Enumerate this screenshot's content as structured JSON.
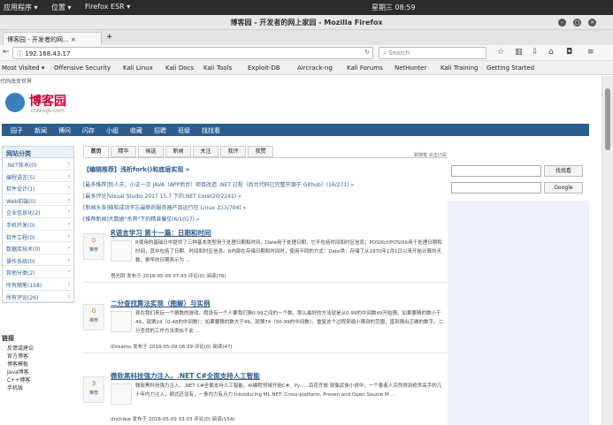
{
  "gnome": {
    "apps": "应用程序 ▾",
    "places": "位置 ▾",
    "firefox": "Firefox ESR ▾",
    "clock": "星期三 08:59"
  },
  "window": {
    "title": "博客园 - 开发者的网上家园 - Mozilla Firefox"
  },
  "tab": {
    "label": "博客园 - 开发者的网... ×",
    "new_tab": "+"
  },
  "nav": {
    "url": "192.168.43.17",
    "search_placeholder": "Search"
  },
  "bookmarks": [
    "Most Visited ▾",
    "Offensive Security",
    "Kali Linux",
    "Kali Docs",
    "Kali Tools",
    "Exploit-DB",
    "Aircrack-ng",
    "Kali Forums",
    "NetHunter",
    "Kali Training",
    "Getting Started"
  ],
  "page": {
    "topline": "代码改变世界",
    "logo_name": "博客园",
    "logo_sub": "cnblogs.com",
    "menu": [
      "园子",
      "新闻",
      "博问",
      "闪存",
      "小组",
      "收藏",
      "招聘",
      "班级",
      "找找看"
    ],
    "sidebar_title": "网站分类",
    "sidebar_items": [
      ".NET技术(0)",
      "编程语言(5)",
      "软件设计(1)",
      "Web前端(0)",
      "企业信息化(2)",
      "手机开发(0)",
      "软件工程(0)",
      "数据库技术(0)",
      "操作系统(0)",
      "其他分类(2)",
      "所有随笔(158)",
      "所有评论(26)"
    ],
    "links_title": "链接",
    "links": [
      "反馈或建议",
      "官方博客",
      "博客模板",
      "Java博客",
      "C++博客",
      "手机版"
    ],
    "tabs": [
      "首页",
      "精华",
      "候选",
      "新闻",
      "关注",
      "我评",
      "我赞"
    ],
    "hint": "新随笔  点击订阅",
    "rec_title": "【编辑推荐】浅析fork()和底层实现 »",
    "news": [
      "[最多推荐]别人夫，小证一次 JAVA（APP后台）项目改造 .NET 过程（后台代码已完整开源于 Github）(16/271) »",
      "[最多评论]Visual Studio 2017 15.7 下的.NET Core(20/2241) »",
      "[新闻头条]微软成功不忘最新的服务器产品运行在 Linux 上(3/704) »",
      "[推荐新闻]大数据\"杀熟\"下的精准偏见(6/1017) »"
    ],
    "posts": [
      {
        "votes": "0",
        "vote_label": "推荐",
        "title": "R语言学习 第十一篇：日期和时间",
        "desc": "R使用的基础日中提供了三种基本类型用于处理日期和时间，Date用于处理日期，它不包括时间和时区信息；POSIXct/POSIXlt用于处理日期和时间，其中包括了日期、时间和时区信息。R内部在存储日期和时间时，使用不同的方式：Date类：存储了从1970年1月1日以来开始计算的天数，更早的日期表示为 ...",
        "meta": "悦光阴 发布于 2018-05-09 07:43 评论(0) 阅读(76)"
      },
      {
        "votes": "0",
        "vote_label": "推荐",
        "title": "二分查找算法实现（图解）与实例",
        "desc": "现在我们来玩一个猜数的游戏，假设有一个人要我们猜0-99之间的一个数。那么最好的方法就是从0-99的中间数49开始猜。如果要猜的数小于49，就猜24（0-48的中间数）；如果要猜的数大于49，就猜74（50-99的中间数）。重复这个过程来缩小猜测的范围，直到猜出正确的数字。二分查找的工作方法类似于此 ...",
        "meta": "IDreamo 发布于 2018-05-09 06:39 评论(0) 阅读(47)"
      },
      {
        "votes": "3",
        "vote_label": "推荐",
        "title": "微软黑科技强力注入，.NET C#全面支持人工智能",
        "desc": "微软黑科技强力注入，.NET C#全面支持人工智能，AI编程领域开始C#、Py......百花齐放 就像武侠小说中，一个善者人突然得到绝世高手的几十年内力注入，顿式还没有，一身内力有点力 Introducing ML.NET: Cross-platform, Proven and Open Source M ...",
        "meta": "dnchiew 发布于 2018-05-09 03:03 评论(0) 阅读(154)"
      }
    ],
    "right": {
      "search_btn": "找找看",
      "google_btn": "Google"
    }
  }
}
